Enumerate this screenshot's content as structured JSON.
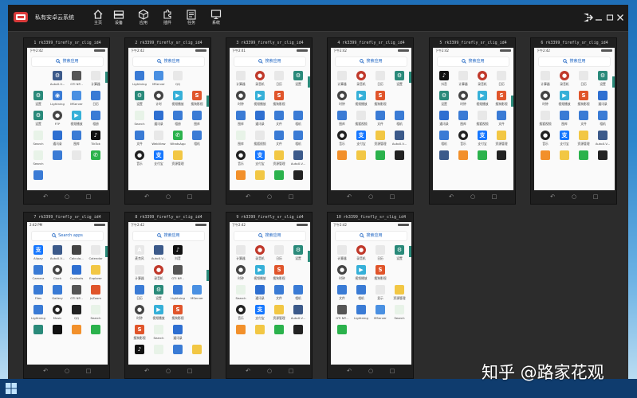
{
  "app": {
    "title": "私有安卓云系统"
  },
  "nav": [
    {
      "label": "主页",
      "icon": "home-icon"
    },
    {
      "label": "设备",
      "icon": "devices-icon"
    },
    {
      "label": "应用",
      "icon": "apps-cube-icon"
    },
    {
      "label": "插件",
      "icon": "plugin-icon"
    },
    {
      "label": "任务",
      "icon": "tasks-icon"
    },
    {
      "label": "系统",
      "icon": "monitor-icon"
    }
  ],
  "colors": {
    "accent": "#2a8a7a",
    "search_text": "#1d64c2",
    "topbar": "#1b1b1b",
    "window": "#2c2c2c"
  },
  "phones": [
    {
      "title": "1 rk3399_firefly_sr_clig_id4",
      "time": "下午2:42",
      "search": "搜索应用",
      "apps": [
        [
          "",
          "",
          ""
        ],
        [
          "AutoX.V...",
          "#3c5a8a",
          "⚙"
        ],
        [
          "GTI NP...",
          "#555",
          ""
        ],
        [
          "计算器",
          "#e8e8e8",
          ""
        ],
        [
          "设置",
          "#2a8a7a",
          "⚙"
        ],
        [
          "Lightning",
          "#3a7bd5",
          "◉"
        ],
        [
          "MServer",
          "#4a90e2",
          ""
        ],
        [
          "日历",
          "#3a7bd5",
          ""
        ],
        [
          "设置",
          "#2a8a7a",
          "⚙"
        ],
        [
          "FTP",
          "#444",
          "●"
        ],
        [
          "视频播放",
          "#36b0d8",
          "▶"
        ],
        [
          "相册",
          "#3a7bd5",
          ""
        ],
        [
          "Search",
          "#e8f3e8",
          ""
        ],
        [
          "通讯录",
          "#2e6fd1",
          ""
        ],
        [
          "图库",
          "#3a7bd5",
          ""
        ],
        [
          "TikTok",
          "#111",
          "♪"
        ],
        [
          "Search",
          "#e8f3e8",
          ""
        ],
        [
          "",
          "#3a7bd5",
          ""
        ],
        [
          "",
          "#e8e8e8",
          ""
        ],
        [
          "",
          "#2bb24c",
          "✆"
        ],
        [
          "",
          "#3a7bd5",
          ""
        ]
      ]
    },
    {
      "title": "2 rk3399_firefly_sr_clig_id4",
      "time": "下午2:42",
      "search": "搜索应用",
      "apps": [
        [
          "Lightning",
          "#3a7bd5",
          ""
        ],
        [
          "MServer",
          "#4a90e2",
          ""
        ],
        [
          "QQ",
          "#e8e8e8",
          ""
        ],
        [
          "",
          "",
          ""
        ],
        [
          "设置",
          "#2a8a7a",
          "⚙"
        ],
        [
          "计时",
          "#444",
          "●"
        ],
        [
          "视频播放",
          "#36b0d8",
          "▶"
        ],
        [
          "搜狗影视",
          "#e0552b",
          "S"
        ],
        [
          "Search",
          "#e8f3e8",
          ""
        ],
        [
          "通讯录",
          "#2e6fd1",
          ""
        ],
        [
          "相册",
          "#3a7bd5",
          ""
        ],
        [
          "图库",
          "#3a7bd5",
          ""
        ],
        [
          "文件",
          "#3a7bd5",
          ""
        ],
        [
          "WebView",
          "#e8e8e8",
          ""
        ],
        [
          "WhatsApp",
          "#2bb24c",
          "✆"
        ],
        [
          "相机",
          "#3a7bd5",
          ""
        ],
        [
          "音乐",
          "#222",
          "●"
        ],
        [
          "支付宝",
          "#1677ff",
          "支"
        ],
        [
          "资源管理",
          "#f2c744",
          ""
        ],
        [
          "",
          "",
          ""
        ]
      ]
    },
    {
      "title": "3 rk3399_firefly_sr_clig_id4",
      "time": "下午2:41",
      "search": "搜索应用",
      "apps": [
        [
          "计算器",
          "#e8e8e8",
          ""
        ],
        [
          "录音机",
          "#c0392b",
          "●"
        ],
        [
          "日历",
          "#e8e8e8",
          ""
        ],
        [
          "设置",
          "#2a8a7a",
          "⚙"
        ],
        [
          "时钟",
          "#444",
          "●"
        ],
        [
          "视频播放",
          "#36b0d8",
          "▶"
        ],
        [
          "搜狗影视",
          "#e0552b",
          "S"
        ],
        [
          "",
          "",
          ""
        ],
        [
          "图库",
          "#3a7bd5",
          ""
        ],
        [
          "通讯录",
          "#2e6fd1",
          ""
        ],
        [
          "文件",
          "#3a7bd5",
          ""
        ],
        [
          "相机",
          "#3a7bd5",
          ""
        ],
        [
          "图库",
          "#e8f3e8",
          ""
        ],
        [
          "搜狐视频",
          "#e8e8e8",
          ""
        ],
        [
          "文件",
          "#3a7bd5",
          ""
        ],
        [
          "相机",
          "#3a7bd5",
          ""
        ],
        [
          "音乐",
          "#222",
          "●"
        ],
        [
          "支付宝",
          "#1677ff",
          "支"
        ],
        [
          "资源管理",
          "#f2c744",
          ""
        ],
        [
          "AutoX.V...",
          "#3c5a8a",
          ""
        ],
        [
          "",
          "#f2902b",
          ""
        ],
        [
          "",
          "#f2c744",
          ""
        ],
        [
          "",
          "#2bb24c",
          ""
        ],
        [
          "",
          "#222",
          ""
        ]
      ]
    },
    {
      "title": "4 rk3399_firefly_sr_clig_id4",
      "time": "下午2:42",
      "search": "搜索应用",
      "apps": [
        [
          "计算器",
          "#e8e8e8",
          ""
        ],
        [
          "录音机",
          "#c0392b",
          "●"
        ],
        [
          "日历",
          "#e8e8e8",
          ""
        ],
        [
          "设置",
          "#2a8a7a",
          "⚙"
        ],
        [
          "时钟",
          "#444",
          "●"
        ],
        [
          "视频播放",
          "#36b0d8",
          "▶"
        ],
        [
          "搜狗影视",
          "#e0552b",
          "S"
        ],
        [
          "",
          "",
          ""
        ],
        [
          "图库",
          "#3a7bd5",
          ""
        ],
        [
          "搜狐视频",
          "#e8e8e8",
          ""
        ],
        [
          "文件",
          "#3a7bd5",
          ""
        ],
        [
          "相机",
          "#3a7bd5",
          ""
        ],
        [
          "音乐",
          "#222",
          "●"
        ],
        [
          "支付宝",
          "#1677ff",
          "支"
        ],
        [
          "资源管理",
          "#f2c744",
          ""
        ],
        [
          "AutoX.V...",
          "#3c5a8a",
          ""
        ],
        [
          "",
          "#f2902b",
          ""
        ],
        [
          "",
          "#f2c744",
          ""
        ],
        [
          "",
          "#2bb24c",
          ""
        ],
        [
          "",
          "#222",
          ""
        ]
      ]
    },
    {
      "title": "5 rk3399_firefly_sr_clig_id4",
      "time": "下午2:42",
      "search": "搜索应用",
      "apps": [
        [
          "抖音",
          "#111",
          "♪"
        ],
        [
          "计算器",
          "#e8e8e8",
          ""
        ],
        [
          "录音机",
          "#c0392b",
          "●"
        ],
        [
          "日历",
          "#e8e8e8",
          ""
        ],
        [
          "设置",
          "#2a8a7a",
          "⚙"
        ],
        [
          "时钟",
          "#444",
          "●"
        ],
        [
          "视频播放",
          "#36b0d8",
          "▶"
        ],
        [
          "搜狗影视",
          "#e0552b",
          "S"
        ],
        [
          "通讯录",
          "#2e6fd1",
          ""
        ],
        [
          "图库",
          "#3a7bd5",
          ""
        ],
        [
          "搜狐视频",
          "#e8e8e8",
          ""
        ],
        [
          "文件",
          "#3a7bd5",
          ""
        ],
        [
          "相机",
          "#3a7bd5",
          ""
        ],
        [
          "音乐",
          "#222",
          "●"
        ],
        [
          "支付宝",
          "#1677ff",
          "支"
        ],
        [
          "资源管理",
          "#f2c744",
          ""
        ],
        [
          "",
          "#3c5a8a",
          ""
        ],
        [
          "",
          "#f2902b",
          ""
        ],
        [
          "",
          "#2bb24c",
          ""
        ],
        [
          "",
          "#222",
          ""
        ]
      ]
    },
    {
      "title": "6 rk3399_firefly_sr_clig_id4",
      "time": "下午2:42",
      "search": "搜索应用",
      "apps": [
        [
          "计算器",
          "#e8e8e8",
          ""
        ],
        [
          "录音机",
          "#c0392b",
          "●"
        ],
        [
          "日历",
          "#e8e8e8",
          ""
        ],
        [
          "设置",
          "#2a8a7a",
          "⚙"
        ],
        [
          "时钟",
          "#444",
          "●"
        ],
        [
          "视频播放",
          "#36b0d8",
          "▶"
        ],
        [
          "搜狗影视",
          "#e0552b",
          "S"
        ],
        [
          "通讯录",
          "#2e6fd1",
          ""
        ],
        [
          "搜狐视频",
          "#e8e8e8",
          ""
        ],
        [
          "图库",
          "#3a7bd5",
          ""
        ],
        [
          "文件",
          "#3a7bd5",
          ""
        ],
        [
          "相机",
          "#3a7bd5",
          ""
        ],
        [
          "音乐",
          "#222",
          "●"
        ],
        [
          "支付宝",
          "#1677ff",
          "支"
        ],
        [
          "资源管理",
          "#f2c744",
          ""
        ],
        [
          "AutoX.V...",
          "#3c5a8a",
          ""
        ],
        [
          "",
          "#f2902b",
          ""
        ],
        [
          "",
          "#f2c744",
          ""
        ],
        [
          "",
          "#2bb24c",
          ""
        ],
        [
          "",
          "#222",
          ""
        ]
      ]
    },
    {
      "title": "7 rk3399_firefly_sr_clig_id4",
      "time": "2:42 PM",
      "search": "Search apps",
      "apps": [
        [
          "Alipay",
          "#1677ff",
          "支"
        ],
        [
          "AutoX.V...",
          "#3c5a8a",
          ""
        ],
        [
          "Calcula...",
          "#444",
          ""
        ],
        [
          "Calendar",
          "#e8e8e8",
          ""
        ],
        [
          "Camera",
          "#3a7bd5",
          ""
        ],
        [
          "Clock",
          "#444",
          "●"
        ],
        [
          "Contacts",
          "#2e6fd1",
          ""
        ],
        [
          "Explorer",
          "#f2c744",
          ""
        ],
        [
          "Files",
          "#3a7bd5",
          ""
        ],
        [
          "Gallery",
          "#3a7bd5",
          ""
        ],
        [
          "GTI NP...",
          "#555",
          ""
        ],
        [
          "JsZoom",
          "#e0552b",
          ""
        ],
        [
          "Lightning",
          "#3a7bd5",
          ""
        ],
        [
          "Music",
          "#222",
          "●"
        ],
        [
          "QQ",
          "#222",
          ""
        ],
        [
          "Search",
          "#e8f3e8",
          ""
        ],
        [
          "",
          "#2a8a7a",
          ""
        ],
        [
          "",
          "#111",
          ""
        ],
        [
          "",
          "#f2902b",
          ""
        ],
        [
          "",
          "#2bb24c",
          ""
        ]
      ]
    },
    {
      "title": "8 rk3399_firefly_sr_clig_id4",
      "time": "下午2:42",
      "search": "搜索应用",
      "apps": [
        [
          "麦克风",
          "#e8e8e8",
          "A"
        ],
        [
          "AutoX.V...",
          "#3c5a8a",
          ""
        ],
        [
          "抖音",
          "#111",
          "♪"
        ],
        [
          "",
          "",
          ""
        ],
        [
          "计算器",
          "#e8e8e8",
          ""
        ],
        [
          "录音机",
          "#c0392b",
          "●"
        ],
        [
          "GTI NP...",
          "#555",
          ""
        ],
        [
          "",
          "",
          ""
        ],
        [
          "日历",
          "#3a7bd5",
          ""
        ],
        [
          "设置",
          "#2a8a7a",
          "⚙"
        ],
        [
          "Lightning",
          "#3a7bd5",
          ""
        ],
        [
          "MServer",
          "#4a90e2",
          ""
        ],
        [
          "时钟",
          "#444",
          "●"
        ],
        [
          "视频播放",
          "#36b0d8",
          "▶"
        ],
        [
          "搜狗影视",
          "#e0552b",
          "S"
        ],
        [
          "",
          "",
          ""
        ],
        [
          "搜狗影视",
          "#e0552b",
          "S"
        ],
        [
          "Search",
          "#e8f3e8",
          ""
        ],
        [
          "通讯录",
          "#2e6fd1",
          ""
        ],
        [
          "",
          "",
          ""
        ],
        [
          "",
          "#111",
          "♪"
        ],
        [
          "",
          "#e8f3e8",
          ""
        ],
        [
          "",
          "#3a7bd5",
          ""
        ],
        [
          "",
          "#f2c744",
          ""
        ]
      ]
    },
    {
      "title": "9 rk3399_firefly_sr_clig_id4",
      "time": "下午2:42",
      "search": "搜索应用",
      "apps": [
        [
          "计算器",
          "#e8e8e8",
          ""
        ],
        [
          "录音机",
          "#c0392b",
          "●"
        ],
        [
          "日历",
          "#e8e8e8",
          ""
        ],
        [
          "设置",
          "#2a8a7a",
          "⚙"
        ],
        [
          "时钟",
          "#444",
          "●"
        ],
        [
          "视频播放",
          "#36b0d8",
          "▶"
        ],
        [
          "搜狗影视",
          "#e0552b",
          "S"
        ],
        [
          "",
          "",
          ""
        ],
        [
          "Search",
          "#e8f3e8",
          ""
        ],
        [
          "通讯录",
          "#2e6fd1",
          ""
        ],
        [
          "文件",
          "#3a7bd5",
          ""
        ],
        [
          "相机",
          "#3a7bd5",
          ""
        ],
        [
          "音乐",
          "#222",
          "●"
        ],
        [
          "支付宝",
          "#1677ff",
          "支"
        ],
        [
          "资源管理",
          "#f2c744",
          ""
        ],
        [
          "AutoX.V...",
          "#3c5a8a",
          ""
        ],
        [
          "",
          "#f2902b",
          ""
        ],
        [
          "",
          "#f2c744",
          ""
        ],
        [
          "",
          "#2bb24c",
          ""
        ],
        [
          "",
          "#222",
          ""
        ]
      ]
    },
    {
      "title": "10 rk3399_firefly_sr_clig_id4",
      "time": "下午2:42",
      "search": "搜索应用",
      "apps": [
        [
          "计算器",
          "#e8e8e8",
          ""
        ],
        [
          "录音机",
          "#c0392b",
          "●"
        ],
        [
          "日历",
          "#e8e8e8",
          ""
        ],
        [
          "设置",
          "#2a8a7a",
          "⚙"
        ],
        [
          "时钟",
          "#444",
          "●"
        ],
        [
          "视频播放",
          "#36b0d8",
          "▶"
        ],
        [
          "搜狗影视",
          "#e0552b",
          "S"
        ],
        [
          "",
          "",
          ""
        ],
        [
          "文件",
          "#3a7bd5",
          ""
        ],
        [
          "相机",
          "#3a7bd5",
          ""
        ],
        [
          "显示",
          "#e8e8e8",
          ""
        ],
        [
          "资源管理",
          "#f2c744",
          ""
        ],
        [
          "GTI NP...",
          "#555",
          ""
        ],
        [
          "Lightning",
          "#3a7bd5",
          ""
        ],
        [
          "MServer",
          "#4a90e2",
          ""
        ],
        [
          "Search",
          "#e8f3e8",
          ""
        ],
        [
          "",
          "#2bb24c",
          ""
        ],
        [
          "",
          "",
          ""
        ],
        [
          "",
          "",
          ""
        ],
        [
          "",
          "",
          ""
        ]
      ]
    }
  ],
  "watermark": "知乎 @路家花观"
}
